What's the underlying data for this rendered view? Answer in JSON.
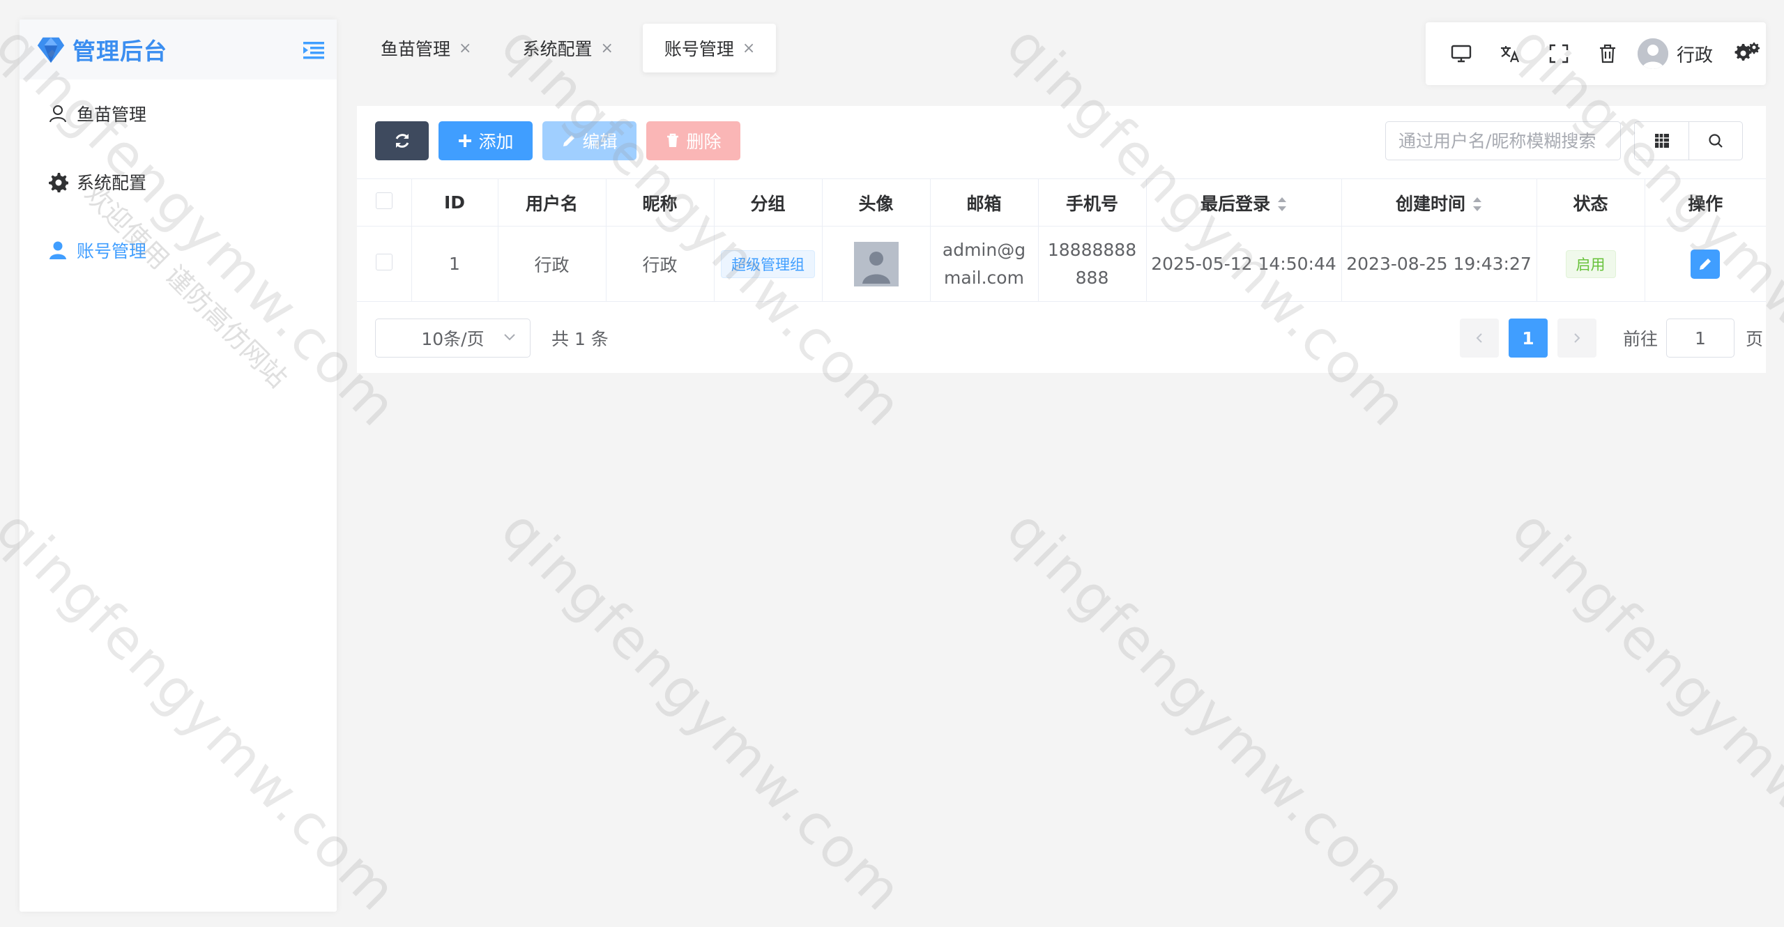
{
  "app": {
    "brand": "管理后台"
  },
  "sidebar": {
    "items": [
      {
        "label": "鱼苗管理",
        "icon": "user-outline-icon",
        "active": false
      },
      {
        "label": "系统配置",
        "icon": "gear-icon",
        "active": false
      },
      {
        "label": "账号管理",
        "icon": "user-filled-icon",
        "active": true
      }
    ]
  },
  "tabs": [
    {
      "label": "鱼苗管理",
      "close": "×",
      "active": false
    },
    {
      "label": "系统配置",
      "close": "×",
      "active": false
    },
    {
      "label": "账号管理",
      "close": "×",
      "active": true
    }
  ],
  "topbar": {
    "user_name": "行政",
    "icons": [
      "monitor-icon",
      "translate-icon",
      "fullscreen-icon",
      "trash-icon",
      "settings-gear-icon"
    ]
  },
  "actions": {
    "add": "添加",
    "edit": "编辑",
    "delete": "删除"
  },
  "search": {
    "placeholder": "通过用户名/昵称模糊搜索"
  },
  "table": {
    "columns": [
      "ID",
      "用户名",
      "昵称",
      "分组",
      "头像",
      "邮箱",
      "手机号",
      "最后登录",
      "创建时间",
      "状态",
      "操作"
    ],
    "rows": [
      {
        "id": "1",
        "username": "行政",
        "nickname": "行政",
        "group": "超级管理组",
        "email": "admin@gmail.com",
        "phone": "18888888888",
        "last_login": "2025-05-12 14:50:44",
        "created": "2023-08-25 19:43:27",
        "status": "启用"
      }
    ]
  },
  "pagination": {
    "page_size": "10条/页",
    "total": "共 1 条",
    "current": "1",
    "goto_label": "前往",
    "goto_value": "1",
    "page_unit": "页"
  },
  "watermark": {
    "text": "qingfengymw.com",
    "text2": "欢迎使用 谨防高仿网站"
  },
  "colors": {
    "primary": "#409eff",
    "dark": "#3e4a5e",
    "danger_light": "#fab6b6",
    "primary_light": "#a0cfff",
    "success": "#67c23a"
  }
}
